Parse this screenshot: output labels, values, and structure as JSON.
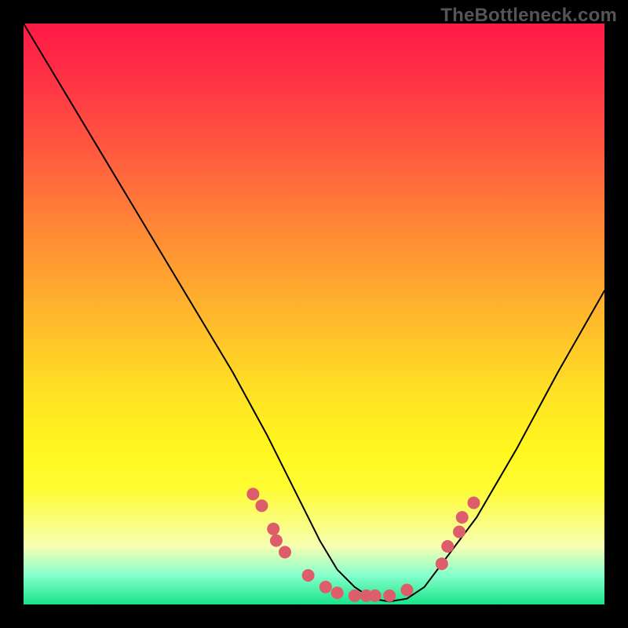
{
  "watermark": "TheBottleneck.com",
  "chart_data": {
    "type": "line",
    "title": "",
    "xlabel": "",
    "ylabel": "",
    "xlim": [
      0,
      100
    ],
    "ylim": [
      0,
      100
    ],
    "grid": false,
    "background": "vertical-rainbow-gradient",
    "series": [
      {
        "name": "bottleneck-curve",
        "x": [
          0,
          6,
          12,
          18,
          24,
          30,
          36,
          42,
          48,
          51,
          54,
          57,
          60,
          63,
          66,
          69,
          72,
          78,
          85,
          92,
          100
        ],
        "y": [
          100,
          90,
          80,
          70,
          60,
          50,
          40,
          29,
          17,
          11,
          6,
          3,
          1,
          0.5,
          1,
          3,
          7,
          15,
          27,
          40,
          54
        ]
      }
    ],
    "markers": {
      "name": "highlighted-points",
      "color": "#dd5d6a",
      "points": [
        {
          "x": 39.5,
          "y": 19.0
        },
        {
          "x": 41.0,
          "y": 17.0
        },
        {
          "x": 43.0,
          "y": 13.0
        },
        {
          "x": 43.5,
          "y": 11.0
        },
        {
          "x": 45.0,
          "y": 9.0
        },
        {
          "x": 49.0,
          "y": 5.0
        },
        {
          "x": 52.0,
          "y": 3.0
        },
        {
          "x": 54.0,
          "y": 2.0
        },
        {
          "x": 57.0,
          "y": 1.5
        },
        {
          "x": 59.0,
          "y": 1.5
        },
        {
          "x": 60.5,
          "y": 1.5
        },
        {
          "x": 63.0,
          "y": 1.5
        },
        {
          "x": 66.0,
          "y": 2.5
        },
        {
          "x": 72.0,
          "y": 7.0
        },
        {
          "x": 73.0,
          "y": 10.0
        },
        {
          "x": 75.0,
          "y": 12.5
        },
        {
          "x": 75.5,
          "y": 15.0
        },
        {
          "x": 77.5,
          "y": 17.5
        }
      ]
    }
  }
}
